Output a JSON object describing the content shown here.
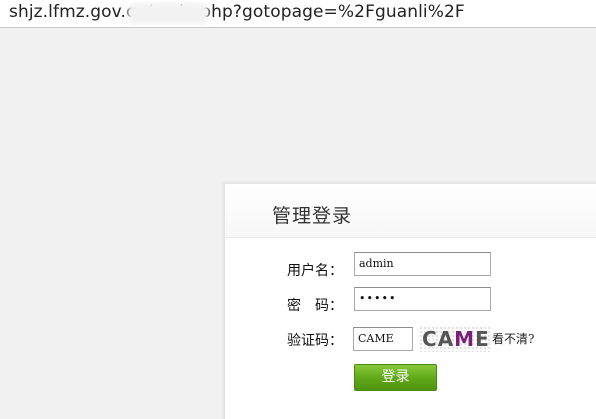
{
  "browser": {
    "url": "shjz.lfmz.gov.cn/          ogin.php?gotopage=%2Fguanli%2F"
  },
  "login_panel": {
    "title": "管理登录",
    "username_label": "用户名：",
    "username_value": "admin",
    "password_label": "密　码：",
    "password_masked": "•••••",
    "captcha_label": "验证码：",
    "captcha_value": "CAME",
    "captcha_image_text": "CAME",
    "captcha_refresh_link": "看不清?",
    "submit_label": "登录"
  },
  "colors": {
    "button_green": "#5ea718",
    "panel_bg": "#ffffff",
    "page_bg": "#f1f1f1"
  }
}
